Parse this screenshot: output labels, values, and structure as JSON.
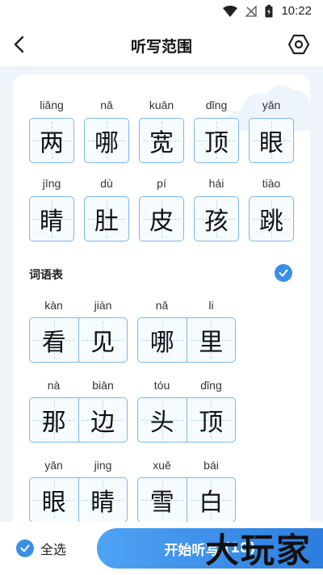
{
  "status": {
    "time": "10:22"
  },
  "header": {
    "title": "听写范围"
  },
  "characters": [
    {
      "pinyin": "liǎng",
      "hanzi": "两"
    },
    {
      "pinyin": "nǎ",
      "hanzi": "哪"
    },
    {
      "pinyin": "kuān",
      "hanzi": "宽"
    },
    {
      "pinyin": "dǐng",
      "hanzi": "顶"
    },
    {
      "pinyin": "yǎn",
      "hanzi": "眼"
    },
    {
      "pinyin": "jīng",
      "hanzi": "睛"
    },
    {
      "pinyin": "dù",
      "hanzi": "肚"
    },
    {
      "pinyin": "pí",
      "hanzi": "皮"
    },
    {
      "pinyin": "hái",
      "hanzi": "孩"
    },
    {
      "pinyin": "tiào",
      "hanzi": "跳"
    }
  ],
  "words_section": {
    "title": "词语表"
  },
  "words": [
    {
      "pinyin": [
        "kàn",
        "jiàn"
      ],
      "hanzi": [
        "看",
        "见"
      ]
    },
    {
      "pinyin": [
        "nǎ",
        "li"
      ],
      "hanzi": [
        "哪",
        "里"
      ]
    },
    {
      "pinyin": [
        "nà",
        "biān"
      ],
      "hanzi": [
        "那",
        "边"
      ]
    },
    {
      "pinyin": [
        "tóu",
        "dǐng"
      ],
      "hanzi": [
        "头",
        "顶"
      ]
    },
    {
      "pinyin": [
        "yǎn",
        "jing"
      ],
      "hanzi": [
        "眼",
        "睛"
      ]
    },
    {
      "pinyin": [
        "xuě",
        "bái"
      ],
      "hanzi": [
        "雪",
        "白"
      ]
    }
  ],
  "bottom": {
    "select_all": "全选",
    "start_label": "开始听写",
    "count": "(18)"
  },
  "watermark": "大玩家",
  "colors": {
    "accent": "#3a8fe6",
    "box_border": "#7fb6ea"
  }
}
